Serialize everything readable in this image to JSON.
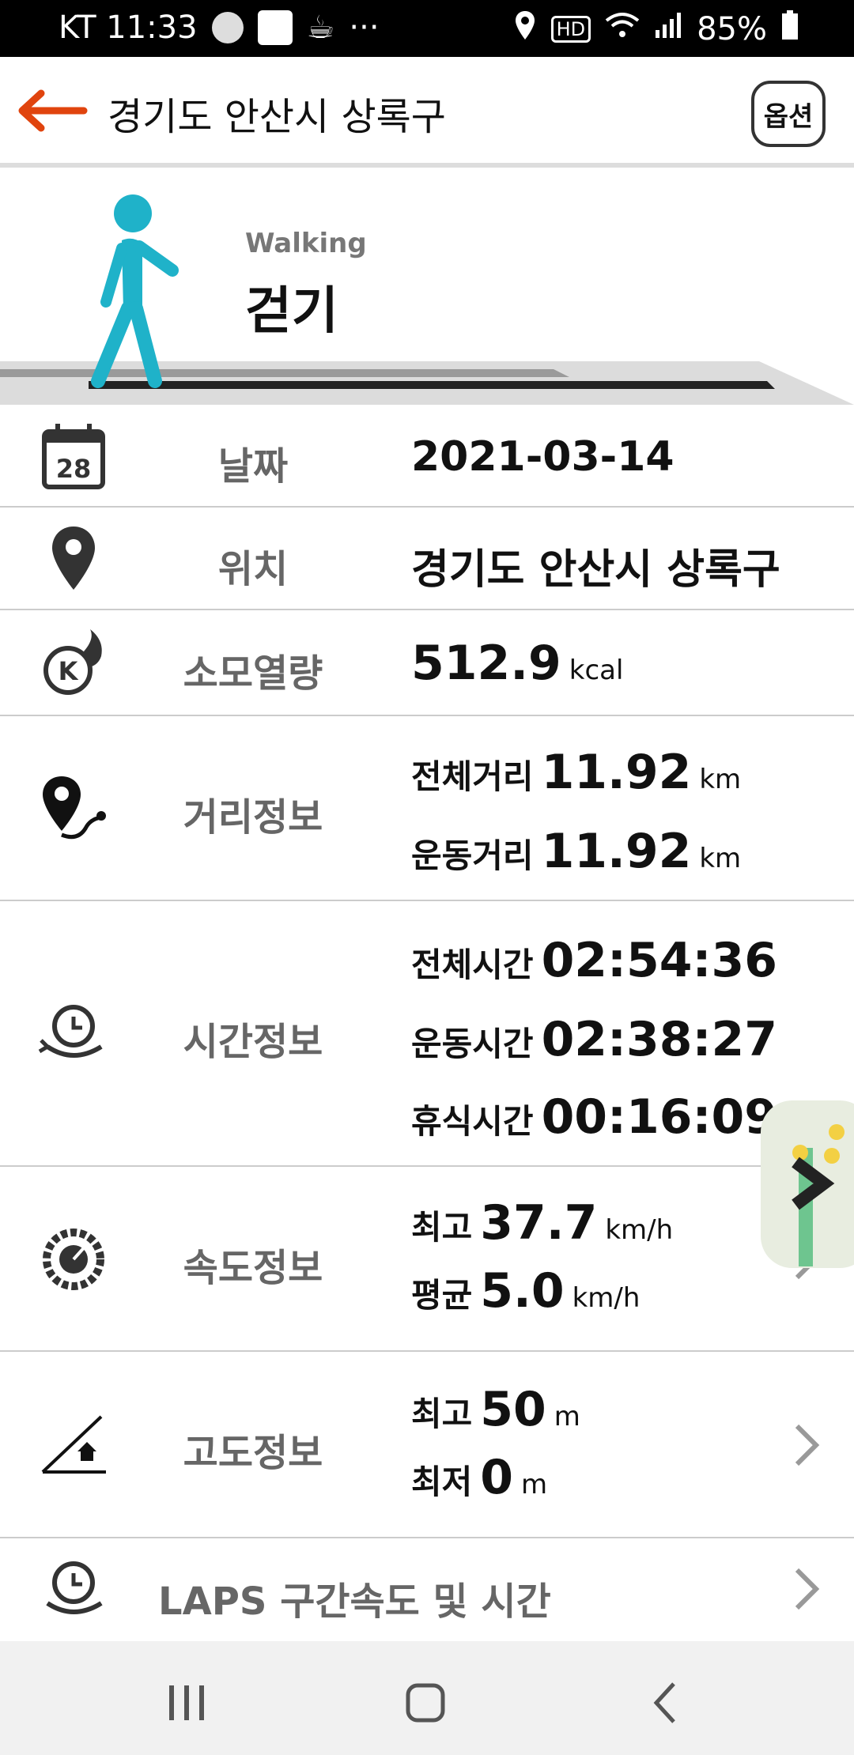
{
  "status_bar": {
    "carrier_time": "KT 11:33",
    "dots": "···",
    "battery": "85%"
  },
  "app_bar": {
    "title": "경기도 안산시 상록구",
    "option_label": "옵션"
  },
  "hero": {
    "english": "Walking",
    "korean": "걷기"
  },
  "rows": {
    "date": {
      "label": "날짜",
      "value": "2021-03-14",
      "calendar_day": "28"
    },
    "location": {
      "label": "위치",
      "value": "경기도 안산시 상록구"
    },
    "calories": {
      "label": "소모열량",
      "value": "512.9",
      "unit": "kcal"
    },
    "distance": {
      "label": "거리정보",
      "total_label": "전체거리",
      "total_value": "11.92",
      "total_unit": "km",
      "exercise_label": "운동거리",
      "exercise_value": "11.92",
      "exercise_unit": "km"
    },
    "time": {
      "label": "시간정보",
      "total_label": "전체시간",
      "total_value": "02:54:36",
      "exercise_label": "운동시간",
      "exercise_value": "02:38:27",
      "rest_label": "휴식시간",
      "rest_value": "00:16:09"
    },
    "speed": {
      "label": "속도정보",
      "max_label": "최고",
      "max_value": "37.7",
      "max_unit": "km/h",
      "avg_label": "평균",
      "avg_value": "5.0",
      "avg_unit": "km/h"
    },
    "altitude": {
      "label": "고도정보",
      "max_label": "최고",
      "max_value": "50",
      "max_unit": "m",
      "min_label": "최저",
      "min_value": "0",
      "min_unit": "m"
    },
    "laps": {
      "label": "LAPS 구간속도 및 시간"
    }
  },
  "colors": {
    "accent": "#e0440e",
    "walker": "#1fb2c9"
  }
}
